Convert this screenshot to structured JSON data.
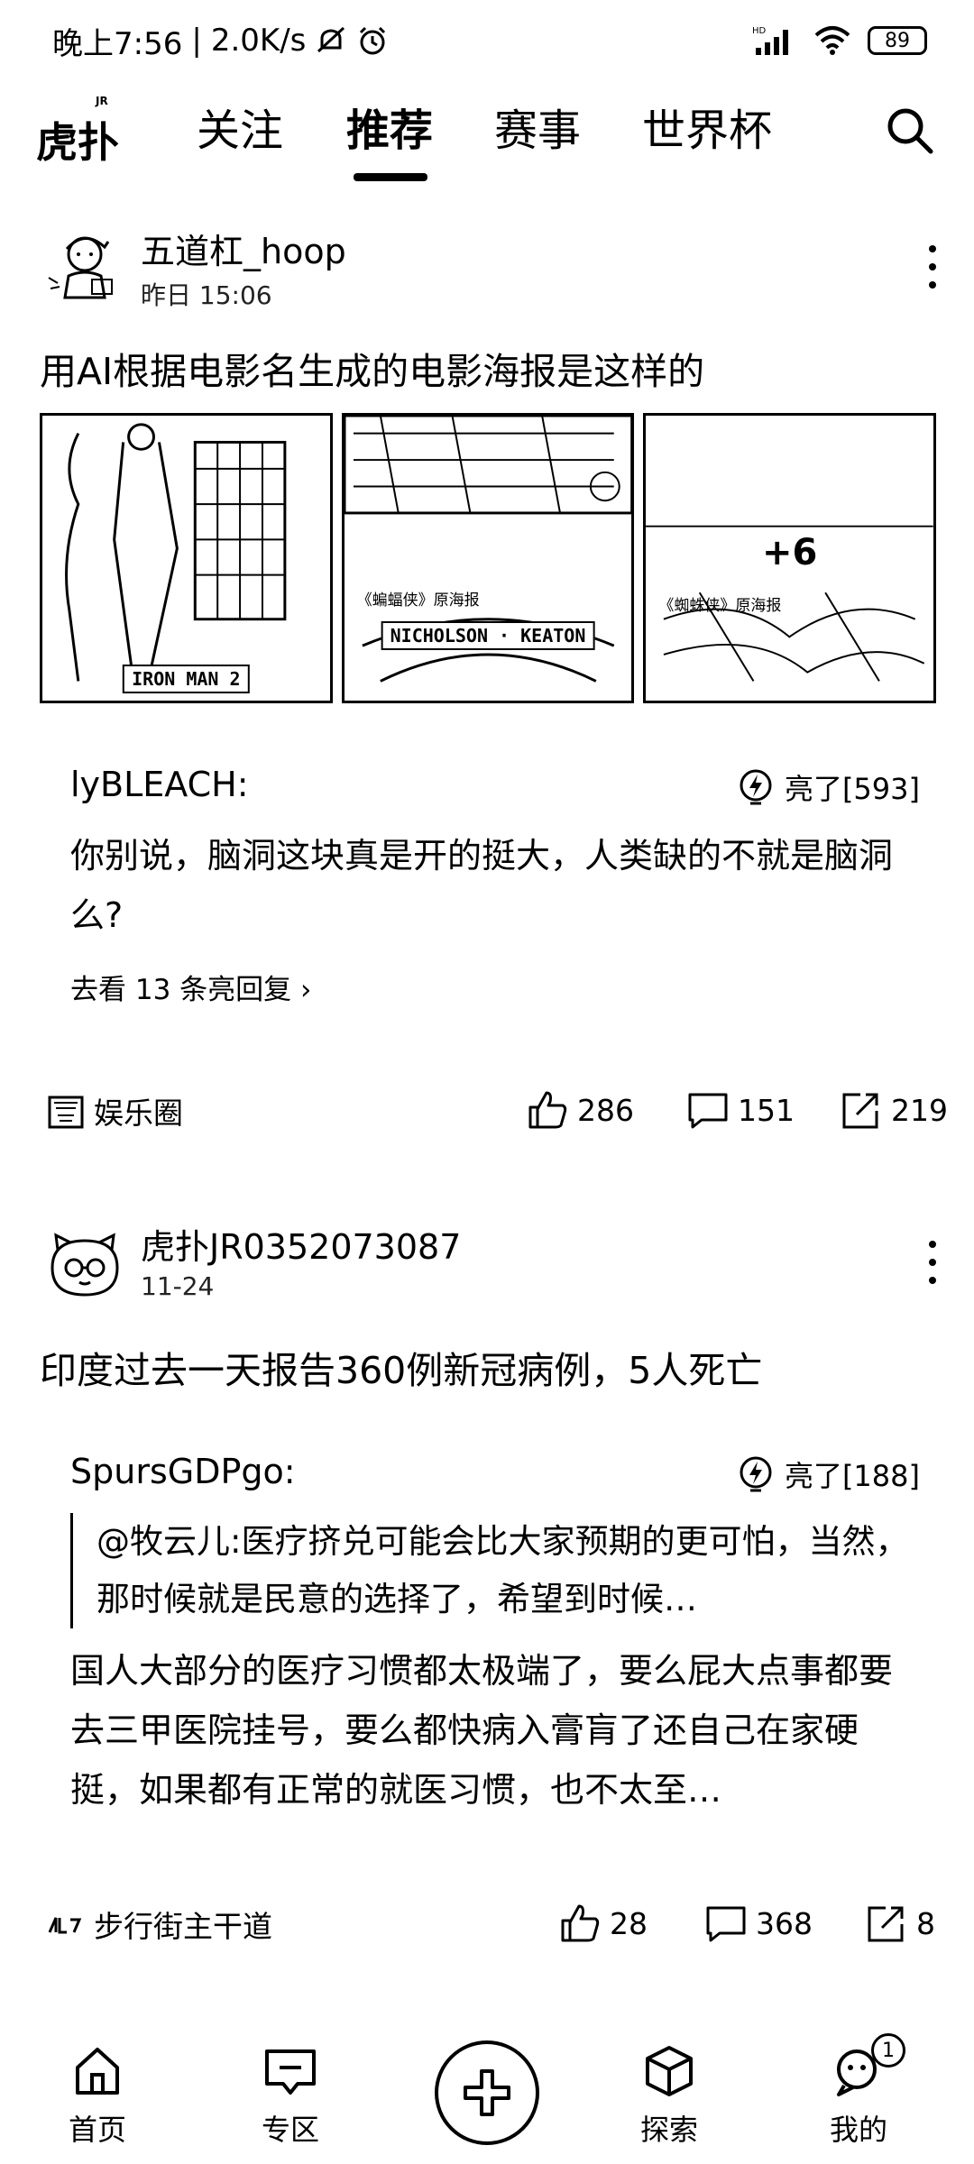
{
  "status_bar": {
    "time": "晚上7:56",
    "net_speed": "2.0K/s",
    "battery": "89"
  },
  "top_nav": {
    "logo_text": "虎扑",
    "logo_sup": "JR",
    "tabs": [
      {
        "label": "关注"
      },
      {
        "label": "推荐"
      },
      {
        "label": "赛事"
      },
      {
        "label": "世界杯"
      }
    ],
    "active_tab": "推荐"
  },
  "posts": [
    {
      "author": "五道杠_hoop",
      "time": "昨日 15:06",
      "title": "用AI根据电影名生成的电影海报是这样的",
      "images": {
        "poster1_band": "IRON MAN 2",
        "poster2_caption": "《蝙蝠侠》原海报",
        "poster2_band": "NICHOLSON · KEATON",
        "poster3_caption": "《蜘蛛侠》原海报",
        "more_count": "+6"
      },
      "comment": {
        "user": "lyBLEACH:",
        "lights": "亮了[593]",
        "text": "你别说，脑洞这块真是开的挺大，人类缺的不就是脑洞么?",
        "see_more": "去看 13 条亮回复 ›"
      },
      "footer": {
        "circle": "娱乐圈",
        "likes": "286",
        "comments": "151",
        "shares": "219"
      }
    },
    {
      "author": "虎扑JR0352073087",
      "time": "11-24",
      "title": "印度过去一天报告360例新冠病例，5人死亡",
      "comment": {
        "user": "SpursGDPgo:",
        "lights": "亮了[188]",
        "quote": "@牧云儿:医疗挤兑可能会比大家预期的更可怕，当然，那时候就是民意的选择了，希望到时候…",
        "text": "国人大部分的医疗习惯都太极端了，要么屁大点事都要去三甲医院挂号，要么都快病入膏肓了还自己在家硬挺，如果都有正常的就医习惯，也不太至…"
      },
      "footer": {
        "circle": "步行街主干道",
        "likes": "28",
        "comments": "368",
        "shares": "8"
      }
    }
  ],
  "bottom_nav": {
    "items": [
      {
        "label": "首页"
      },
      {
        "label": "专区"
      },
      {
        "label": "探索"
      },
      {
        "label": "我的"
      }
    ],
    "badge": "1"
  }
}
